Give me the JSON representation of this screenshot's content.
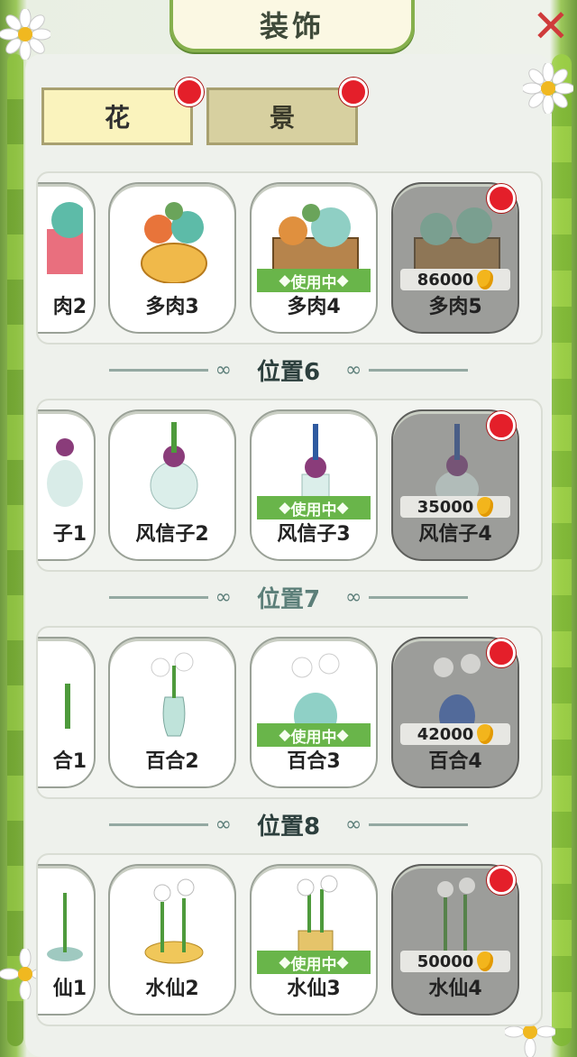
{
  "title": "装饰",
  "tabs": [
    {
      "label": "花",
      "active": true,
      "badge": true
    },
    {
      "label": "景",
      "active": false,
      "badge": true
    }
  ],
  "sections": [
    {
      "heading": null,
      "items": [
        {
          "name": "肉2",
          "partial": true,
          "state": "owned"
        },
        {
          "name": "多肉3",
          "state": "owned"
        },
        {
          "name": "多肉4",
          "state": "in_use",
          "status": "使用中"
        },
        {
          "name": "多肉5",
          "state": "locked",
          "price": "86000",
          "badge": true
        }
      ]
    },
    {
      "heading": "位置6",
      "items": [
        {
          "name": "子1",
          "partial": true,
          "state": "owned"
        },
        {
          "name": "风信子2",
          "state": "owned"
        },
        {
          "name": "风信子3",
          "state": "in_use",
          "status": "使用中"
        },
        {
          "name": "风信子4",
          "state": "locked",
          "price": "35000",
          "badge": true
        }
      ]
    },
    {
      "heading": "位置7",
      "items": [
        {
          "name": "合1",
          "partial": true,
          "state": "owned"
        },
        {
          "name": "百合2",
          "state": "owned"
        },
        {
          "name": "百合3",
          "state": "in_use",
          "status": "使用中"
        },
        {
          "name": "百合4",
          "state": "locked",
          "price": "42000",
          "badge": true
        }
      ]
    },
    {
      "heading": "位置8",
      "items": [
        {
          "name": "仙1",
          "partial": true,
          "state": "owned"
        },
        {
          "name": "水仙2",
          "state": "owned"
        },
        {
          "name": "水仙3",
          "state": "in_use",
          "status": "使用中"
        },
        {
          "name": "水仙4",
          "state": "locked",
          "price": "50000",
          "badge": true
        }
      ]
    }
  ],
  "colors": {
    "badge": "#e41f2a",
    "in_use_bar": "#69b54a",
    "active_tab": "#faf3bd",
    "inactive_tab": "#d7d0a0",
    "vine": "#8dc13f"
  },
  "icons": {
    "close": "close-x-icon",
    "coin": "gold-coin-icon",
    "flower": "daisy-decoration-icon"
  }
}
